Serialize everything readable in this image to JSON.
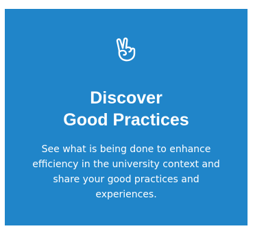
{
  "card": {
    "icon": "hand-peace-icon",
    "title_line1": "Discover",
    "title_line2": "Good Practices",
    "description": "See what is being done to enhance efficiency in the university context and share your good practices and experiences.",
    "background_color": "#2085c9",
    "text_color": "#ffffff"
  }
}
